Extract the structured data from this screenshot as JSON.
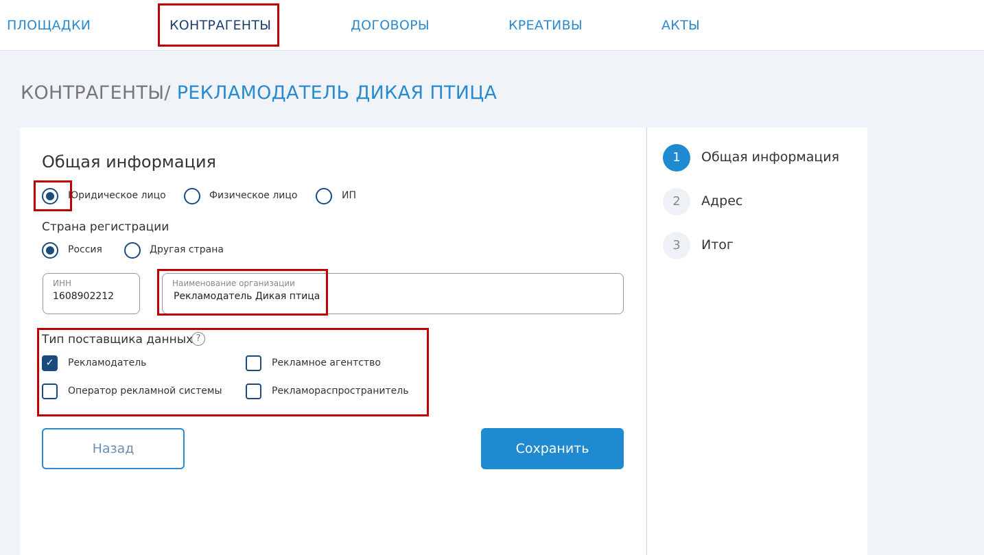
{
  "nav": [
    "ПЛОЩАДКИ",
    "КОНТРАГЕНТЫ",
    "ДОГОВОРЫ",
    "КРЕАТИВЫ",
    "АКТЫ"
  ],
  "breadcrumb": {
    "parent": "КОНТРАГЕНТЫ/",
    "current": " РЕКЛАМОДАТЕЛЬ ДИКАЯ ПТИЦА"
  },
  "form": {
    "title": "Общая информация",
    "entity_types": [
      {
        "label": "Юридическое лицо",
        "selected": true
      },
      {
        "label": "Физическое лицо",
        "selected": false
      },
      {
        "label": "ИП",
        "selected": false
      }
    ],
    "country_label": "Страна регистрации",
    "countries": [
      {
        "label": "Россия",
        "selected": true
      },
      {
        "label": "Другая страна",
        "selected": false
      }
    ],
    "inn": {
      "label": "ИНН",
      "value": "1608902212"
    },
    "org_name": {
      "label": "Наименование организации",
      "value": "Рекламодатель Дикая птица"
    },
    "provider_type_label": "Тип поставщика данных",
    "help_icon": "?",
    "provider_types": [
      {
        "label": "Рекламодатель",
        "checked": true
      },
      {
        "label": "Рекламное агентство",
        "checked": false
      },
      {
        "label": "Оператор рекламной системы",
        "checked": false
      },
      {
        "label": "Рекламораспространитель",
        "checked": false
      }
    ],
    "back": "Назад",
    "save": "Сохранить"
  },
  "steps": [
    {
      "num": "1",
      "label": "Общая информация"
    },
    {
      "num": "2",
      "label": "Адрес"
    },
    {
      "num": "3",
      "label": "Итог"
    }
  ],
  "check_mark": "✓"
}
